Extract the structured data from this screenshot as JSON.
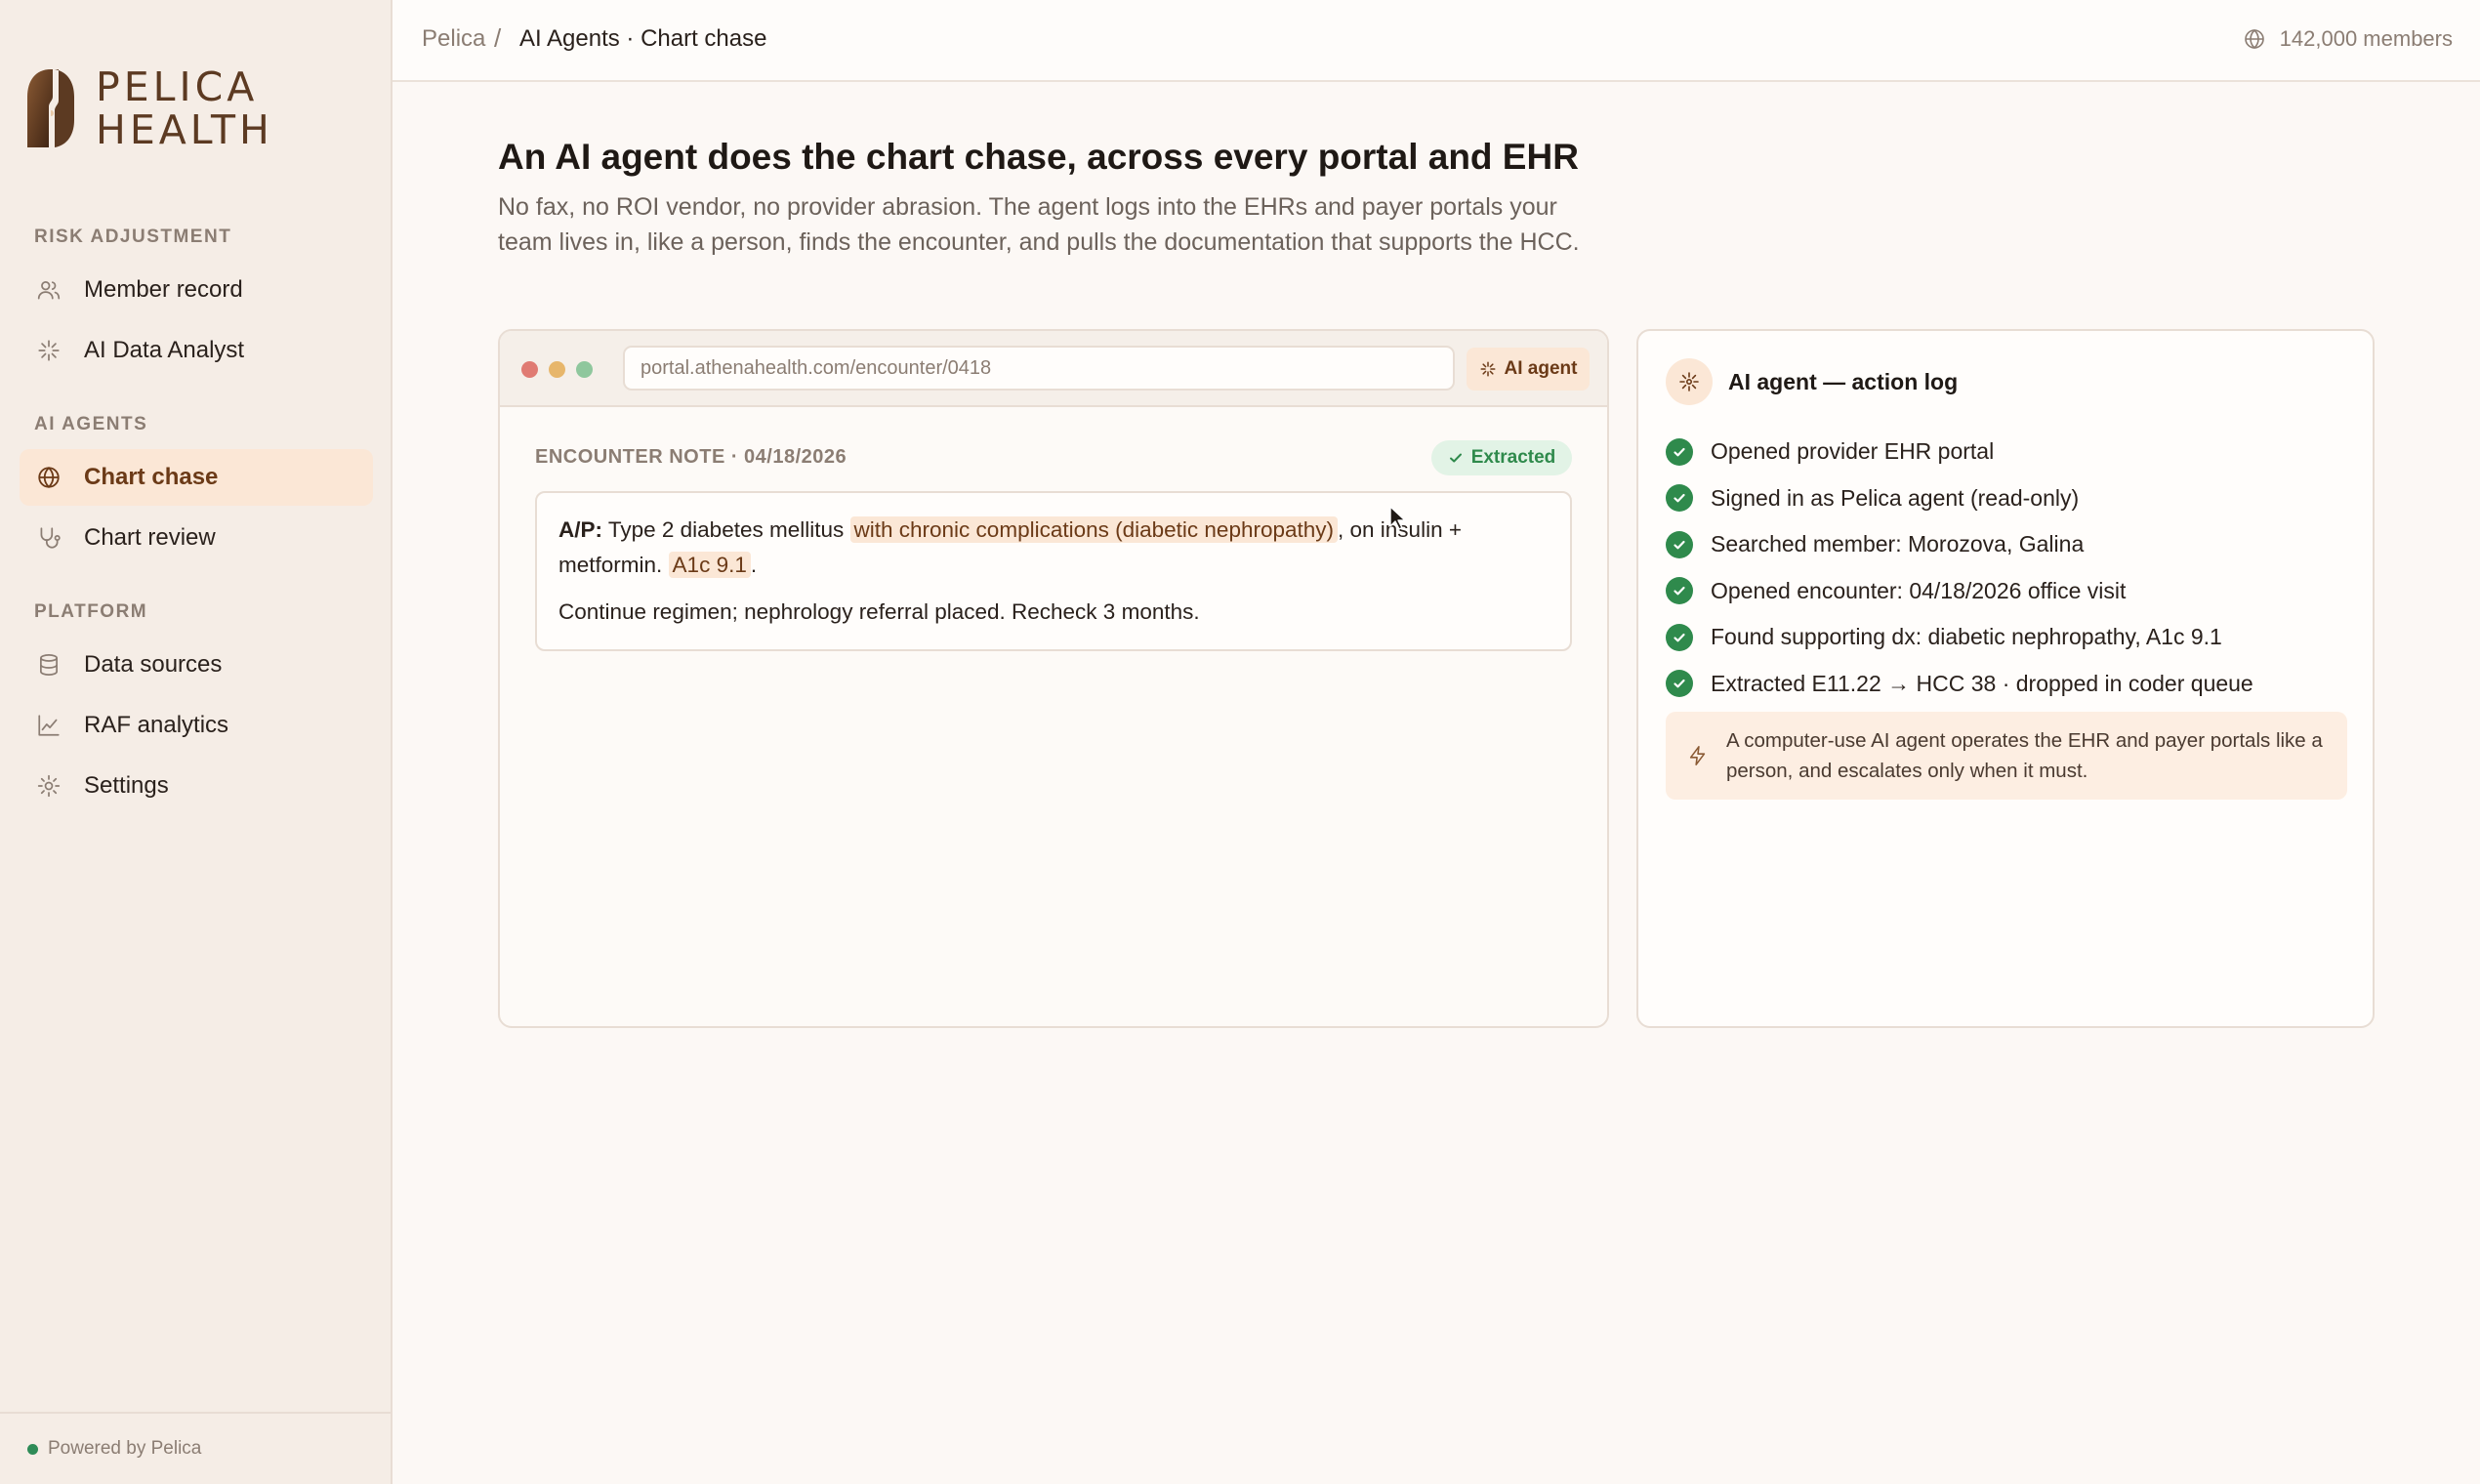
{
  "brand": {
    "line1": "PELICA",
    "line2": "HEALTH"
  },
  "sidebar": {
    "sections": [
      {
        "label": "RISK ADJUSTMENT"
      },
      {
        "label": "AI AGENTS"
      },
      {
        "label": "PLATFORM"
      }
    ],
    "items": [
      {
        "label": "Member record",
        "icon": "users-icon"
      },
      {
        "label": "AI Data Analyst",
        "icon": "sparkle-icon"
      },
      {
        "label": "Chart chase",
        "icon": "globe-icon",
        "active": true
      },
      {
        "label": "Chart review",
        "icon": "stethoscope-icon"
      },
      {
        "label": "Data sources",
        "icon": "database-icon"
      },
      {
        "label": "RAF analytics",
        "icon": "line-chart-icon"
      },
      {
        "label": "Settings",
        "icon": "gear-icon"
      }
    ],
    "footer": "Powered by Pelica"
  },
  "topbar": {
    "breadcrumb_root": "Pelica",
    "breadcrumb_sep": "/",
    "breadcrumb_current": "AI Agents · Chart chase",
    "members": "142,000 members"
  },
  "hero": {
    "title": "An AI agent does the chart chase, across every portal and EHR",
    "subtitle": "No fax, no ROI vendor, no provider abrasion. The agent logs into the EHRs and payer portals your team lives in, like a person, finds the encounter, and pulls the documentation that supports the HCC."
  },
  "browser": {
    "url": "portal.athenahealth.com/encounter/0418",
    "agent_label": "AI agent",
    "note_header": "ENCOUNTER NOTE · 04/18/2026",
    "status": "Extracted",
    "note": {
      "ap_label": "A/P:",
      "text_a": "Type 2 diabetes mellitus",
      "highlight_1": "with chronic complications (diabetic nephropathy)",
      "text_b": ", on insulin +",
      "text_c": "metformin.",
      "highlight_2": "A1c 9.1",
      "text_d": ".",
      "line2": "Continue regimen; nephrology referral placed. Recheck 3 months."
    }
  },
  "log": {
    "title": "AI agent — action log",
    "items": [
      "Opened provider EHR portal",
      "Signed in as Pelica agent (read-only)",
      "Searched member: Morozova, Galina",
      "Opened encounter: 04/18/2026 office visit",
      "Found supporting dx: diabetic nephropathy, A1c 9.1",
      "Extracted E11.22 → HCC 38 · dropped in coder queue"
    ],
    "callout": "A computer-use AI agent operates the EHR and payer portals like a person, and escalates only when it must."
  },
  "colors": {
    "accent": "#6b3a17",
    "accent_bg": "#fbe7d6",
    "success": "#2f8a4c",
    "sidebar_bg": "#f5ede6",
    "page_bg": "#fcf8f5"
  }
}
